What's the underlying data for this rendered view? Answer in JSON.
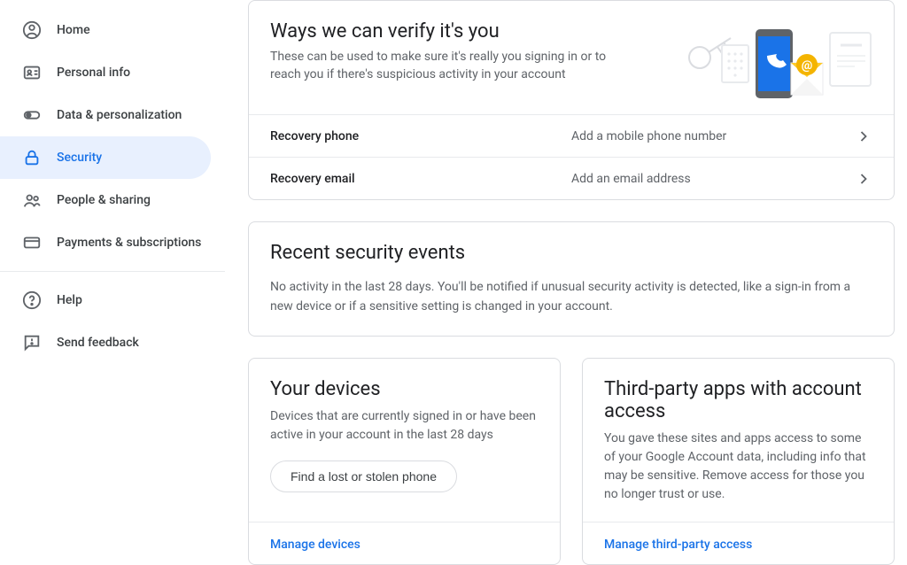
{
  "sidebar": {
    "items": [
      {
        "id": "home",
        "label": "Home"
      },
      {
        "id": "personal-info",
        "label": "Personal info"
      },
      {
        "id": "data-personalization",
        "label": "Data & personalization"
      },
      {
        "id": "security",
        "label": "Security"
      },
      {
        "id": "people-sharing",
        "label": "People & sharing"
      },
      {
        "id": "payments-subscriptions",
        "label": "Payments & subscriptions"
      }
    ],
    "footer": [
      {
        "id": "help",
        "label": "Help"
      },
      {
        "id": "send-feedback",
        "label": "Send feedback"
      }
    ]
  },
  "verify": {
    "title": "Ways we can verify it's you",
    "subtitle": "These can be used to make sure it's really you signing in or to reach you if there's suspicious activity in your account",
    "rows": [
      {
        "label": "Recovery phone",
        "value": "Add a mobile phone number"
      },
      {
        "label": "Recovery email",
        "value": "Add an email address"
      }
    ]
  },
  "events": {
    "title": "Recent security events",
    "body": "No activity in the last 28 days. You'll be notified if unusual security activity is detected, like a sign-in from a new device or if a sensitive setting is changed in your account."
  },
  "devices": {
    "title": "Your devices",
    "subtitle": "Devices that are currently signed in or have been active in your account in the last 28 days",
    "button": "Find a lost or stolen phone",
    "manage": "Manage devices"
  },
  "thirdparty": {
    "title": "Third-party apps with account access",
    "subtitle": "You gave these sites and apps access to some of your Google Account data, including info that may be sensitive. Remove access for those you no longer trust or use.",
    "manage": "Manage third-party access"
  },
  "colors": {
    "accent": "#1a73e8",
    "accentBg": "#e8f0fe",
    "border": "#dadce0",
    "muted": "#5f6368"
  }
}
